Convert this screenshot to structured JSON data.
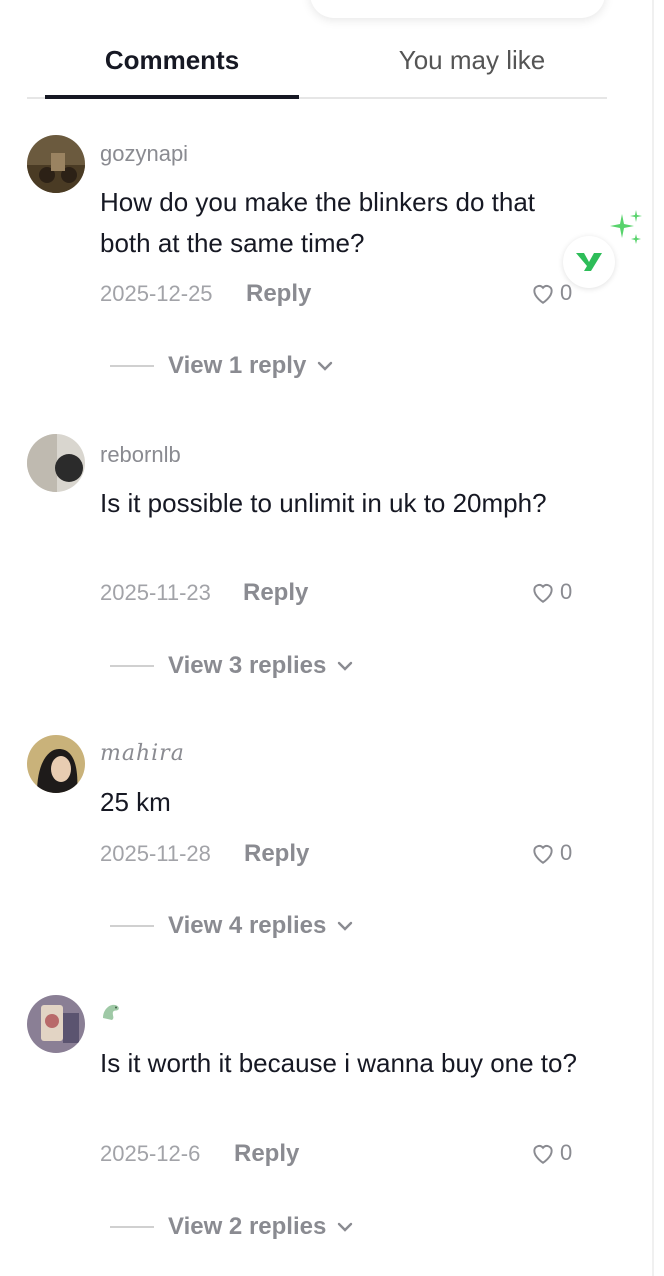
{
  "tabs": {
    "comments": "Comments",
    "you_may_like": "You may like"
  },
  "comments": [
    {
      "username": "gozynapi",
      "text": "How do you make the blinkers do that both at the same time?",
      "date": "2025-12-25",
      "reply_label": "Reply",
      "likes": "0",
      "view_replies": "View 1 reply"
    },
    {
      "username": "rebornlb",
      "text": "Is it possible to unlimit in uk to 20mph?",
      "date": "2025-11-23",
      "reply_label": "Reply",
      "likes": "0",
      "view_replies": "View 3 replies"
    },
    {
      "username": "mahira",
      "text": "25 km",
      "date": "2025-11-28",
      "reply_label": "Reply",
      "likes": "0",
      "view_replies": "View 4 replies"
    },
    {
      "username": "",
      "text": "Is it worth it because i wanna buy one to?",
      "date": "2025-12-6",
      "reply_label": "Reply",
      "likes": "0",
      "view_replies": "View 2 replies"
    }
  ],
  "colors": {
    "accent": "#161823",
    "muted": "#8a8b91",
    "badge_green": "#2ebd59"
  }
}
